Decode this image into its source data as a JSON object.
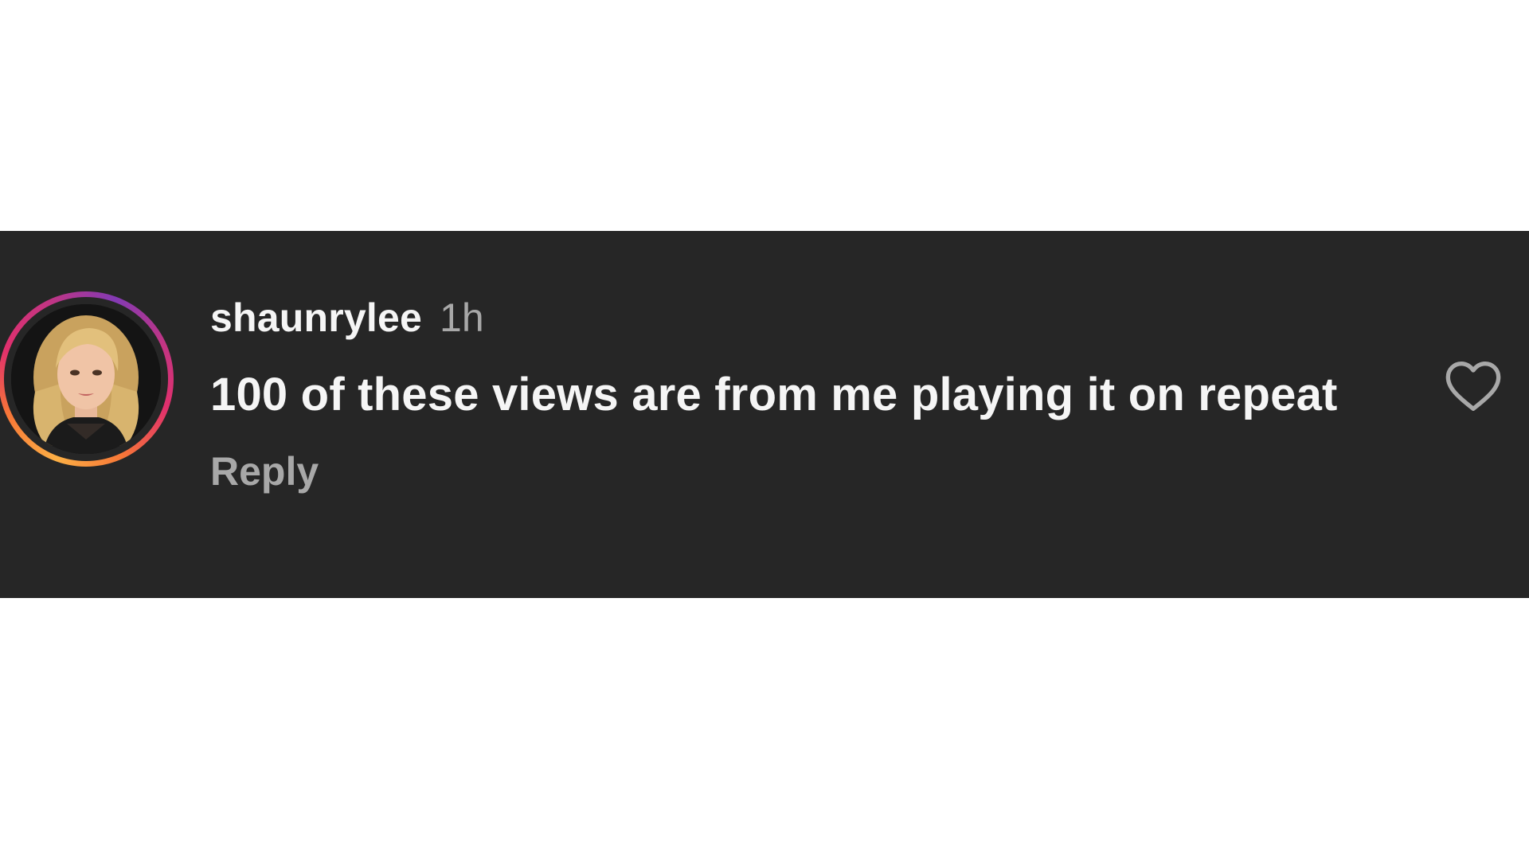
{
  "comment": {
    "username": "shaunrylee",
    "timestamp": "1h",
    "text": "100 of these views are from me playing it on repeat",
    "reply_label": "Reply"
  },
  "icons": {
    "like": "heart-outline-icon",
    "avatar_ring": "story-ring"
  },
  "colors": {
    "card_background": "#262626",
    "page_background": "#ffffff",
    "primary_text": "#f5f5f5",
    "secondary_text": "#a8a8a8",
    "ring_gradient": [
      "#fcaf45",
      "#f77737",
      "#e1306c",
      "#c13584",
      "#833ab4"
    ]
  }
}
